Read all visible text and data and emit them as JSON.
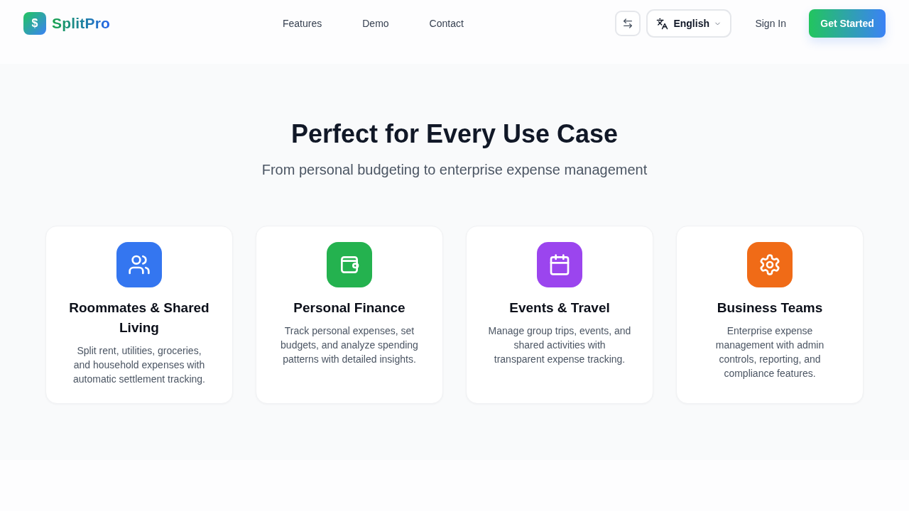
{
  "header": {
    "logo": {
      "mark": "$",
      "name": "SplitPro"
    },
    "nav": [
      "Features",
      "Demo",
      "Contact"
    ],
    "language": {
      "value": "English"
    },
    "sign_in": "Sign In",
    "cta": "Get Started"
  },
  "section": {
    "title": "Perfect for Every Use Case",
    "subtitle": "From personal budgeting to enterprise expense management"
  },
  "cards": [
    {
      "title": "Roommates & Shared Living",
      "description": "Split rent, utilities, groceries, and household expenses with automatic settlement tracking.",
      "color": "#3476f0"
    },
    {
      "title": "Personal Finance",
      "description": "Track personal expenses, set budgets, and analyze spending patterns with detailed insights.",
      "color": "#24b24f"
    },
    {
      "title": "Events & Travel",
      "description": "Manage group trips, events, and shared activities with transparent expense tracking.",
      "color": "#9b45ee"
    },
    {
      "title": "Business Teams",
      "description": "Enterprise expense management with admin controls, reporting, and compliance features.",
      "color": "#f06b17"
    }
  ]
}
